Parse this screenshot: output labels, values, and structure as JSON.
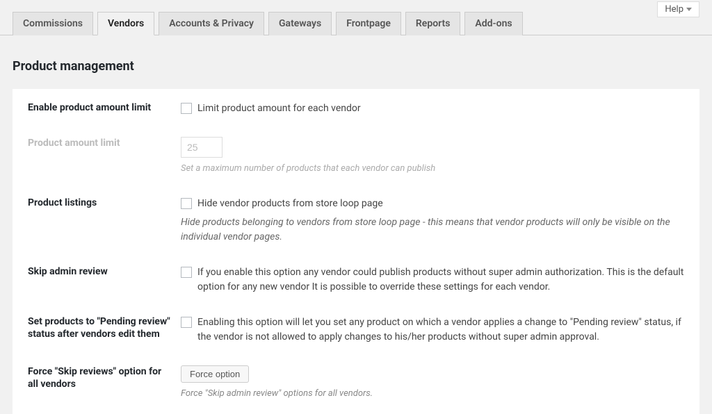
{
  "help": {
    "label": "Help"
  },
  "tabs": [
    {
      "label": "Commissions"
    },
    {
      "label": "Vendors"
    },
    {
      "label": "Accounts & Privacy"
    },
    {
      "label": "Gateways"
    },
    {
      "label": "Frontpage"
    },
    {
      "label": "Reports"
    },
    {
      "label": "Add-ons"
    }
  ],
  "section_title": "Product management",
  "rows": {
    "enable_limit": {
      "label": "Enable product amount limit",
      "checkbox_label": "Limit product amount for each vendor"
    },
    "amount_limit": {
      "label": "Product amount limit",
      "value": "25",
      "desc": "Set a maximum number of products that each vendor can publish"
    },
    "product_listings": {
      "label": "Product listings",
      "checkbox_label": "Hide vendor products from store loop page",
      "desc": "Hide products belonging to vendors from store loop page - this means that vendor products will only be visible on the individual vendor pages."
    },
    "skip_review": {
      "label": "Skip admin review",
      "checkbox_label": "If you enable this option any vendor could publish products without super admin authorization. This is the default option for any new vendor It is possible to override these settings for each vendor."
    },
    "pending_review": {
      "label": "Set products to \"Pending review\" status after vendors edit them",
      "checkbox_label": "Enabling this option will let you set any product on which a vendor applies a change to \"Pending review\" status, if the vendor is not allowed to apply changes to his/her products without super admin approval."
    },
    "force_skip": {
      "label": "Force \"Skip reviews\" option for all vendors",
      "button_label": "Force option",
      "desc": "Force \"Skip admin review\" options for all vendors."
    }
  }
}
